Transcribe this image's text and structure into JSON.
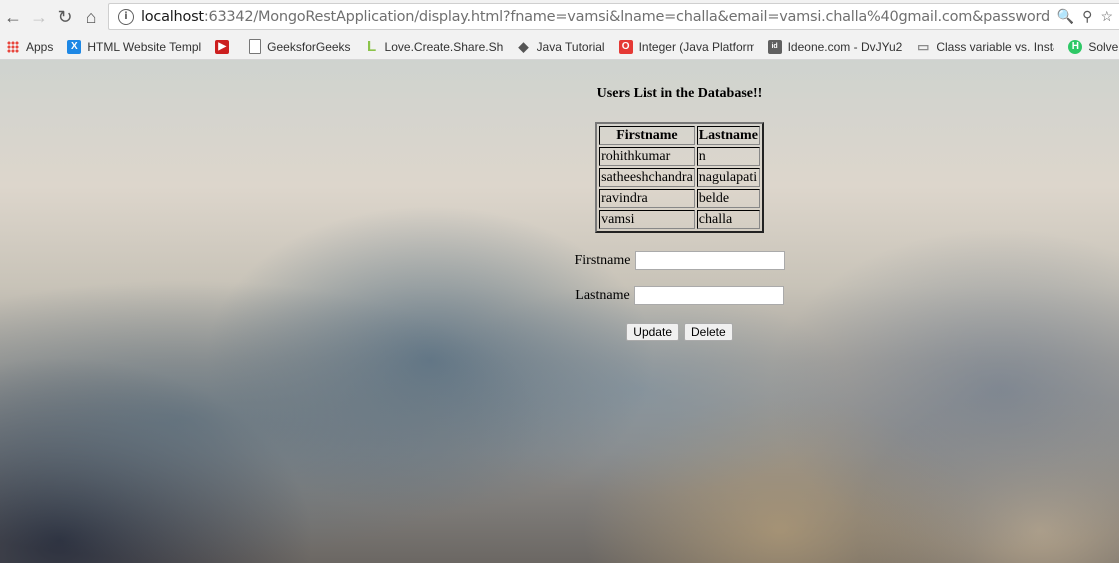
{
  "browser": {
    "url_host": "localhost",
    "url_rest": ":63342/MongoRestApplication/display.html?fname=vamsi&lname=challa&email=vamsi.challa%40gmail.com&password=vamsi&cpassword",
    "bookmarks": [
      {
        "label": "Apps",
        "icon": "apps-grid-icon",
        "color": "#e8453c"
      },
      {
        "label": "HTML Website Templ",
        "icon": "x-logo-icon",
        "color": "#1e88e5"
      },
      {
        "label": "",
        "icon": "youtube-icon",
        "color": "#cc1f1f"
      },
      {
        "label": "GeeksforGeeks",
        "icon": "page-icon",
        "color": "#ffffff"
      },
      {
        "label": "Love.Create.Share.Sho",
        "icon": "l-logo-icon",
        "color": "#8bc34a"
      },
      {
        "label": "Java Tutorial",
        "icon": "diamond-icon",
        "color": "#555555"
      },
      {
        "label": "Integer (Java Platform",
        "icon": "oracle-icon",
        "color": "#e53935"
      },
      {
        "label": "Ideone.com - DvJYu2",
        "icon": "ideone-icon",
        "color": "#606060"
      },
      {
        "label": "Class variable vs. Insta",
        "icon": "laptop-icon",
        "color": "#8a8a8a"
      },
      {
        "label": "Solve Pro",
        "icon": "h-logo-icon",
        "color": "#2ec866"
      }
    ]
  },
  "page": {
    "heading": "Users List in the Database!!",
    "table": {
      "headers": [
        "Firstname",
        "Lastname"
      ],
      "rows": [
        [
          "rohithkumar",
          "n"
        ],
        [
          "satheeshchandra",
          "nagulapati"
        ],
        [
          "ravindra",
          "belde"
        ],
        [
          "vamsi",
          "challa"
        ]
      ]
    },
    "form": {
      "firstname_label": "Firstname",
      "firstname_value": "",
      "lastname_label": "Lastname",
      "lastname_value": "",
      "update_label": "Update",
      "delete_label": "Delete"
    }
  }
}
